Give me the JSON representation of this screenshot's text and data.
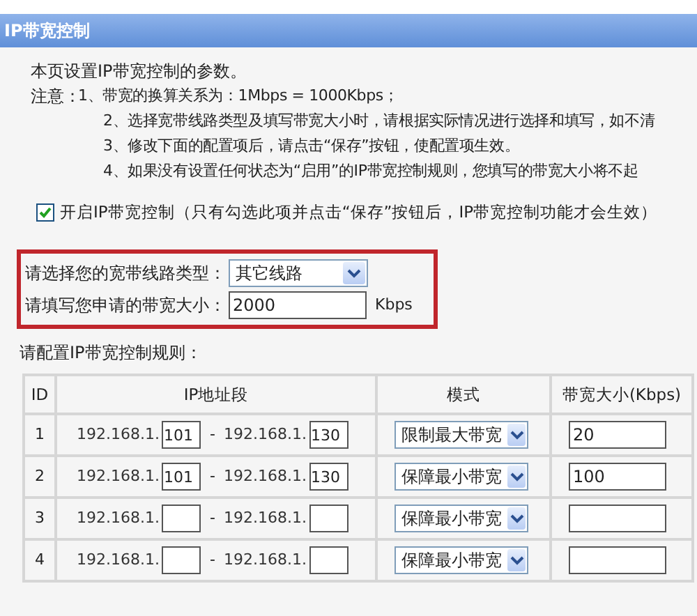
{
  "header": {
    "title": "IP带宽控制"
  },
  "intro": "本页设置IP带宽控制的参数。",
  "notes_label": "注意：",
  "notes": [
    "1、带宽的换算关系为：1Mbps = 1000Kbps；",
    "2、选择宽带线路类型及填写带宽大小时，请根据实际情况进行选择和填写，如不清",
    "3、修改下面的配置项后，请点击“保存”按钮，使配置项生效。",
    "4、如果没有设置任何状态为“启用”的IP带宽控制规则，您填写的带宽大小将不起"
  ],
  "enable": {
    "checked": true,
    "label": "开启IP带宽控制（只有勾选此项并点击“保存”按钮后，IP带宽控制功能才会生效）"
  },
  "line_type": {
    "label": "请选择您的宽带线路类型：",
    "value": "其它线路"
  },
  "bandwidth": {
    "label": "请填写您申请的带宽大小：",
    "value": "2000",
    "unit": "Kbps"
  },
  "rules_label": "请配置IP带宽控制规则：",
  "table": {
    "columns": [
      "ID",
      "IP地址段",
      "模式",
      "带宽大小(Kbps)"
    ],
    "rows": [
      {
        "id": "1",
        "prefix_start": "192.168.1.",
        "start": "101",
        "dash": "-",
        "prefix_end": "192.168.1.",
        "end": "130",
        "mode": "限制最大带宽",
        "bandwidth": "20"
      },
      {
        "id": "2",
        "prefix_start": "192.168.1.",
        "start": "101",
        "dash": "-",
        "prefix_end": "192.168.1.",
        "end": "130",
        "mode": "保障最小带宽",
        "bandwidth": "100"
      },
      {
        "id": "3",
        "prefix_start": "192.168.1.",
        "dash": "-",
        "prefix_end": "192.168.1.",
        "mode": "保障最小带宽"
      },
      {
        "id": "4",
        "prefix_start": "192.168.1.",
        "dash": "-",
        "prefix_end": "192.168.1.",
        "mode": "保障最小带宽"
      }
    ]
  }
}
